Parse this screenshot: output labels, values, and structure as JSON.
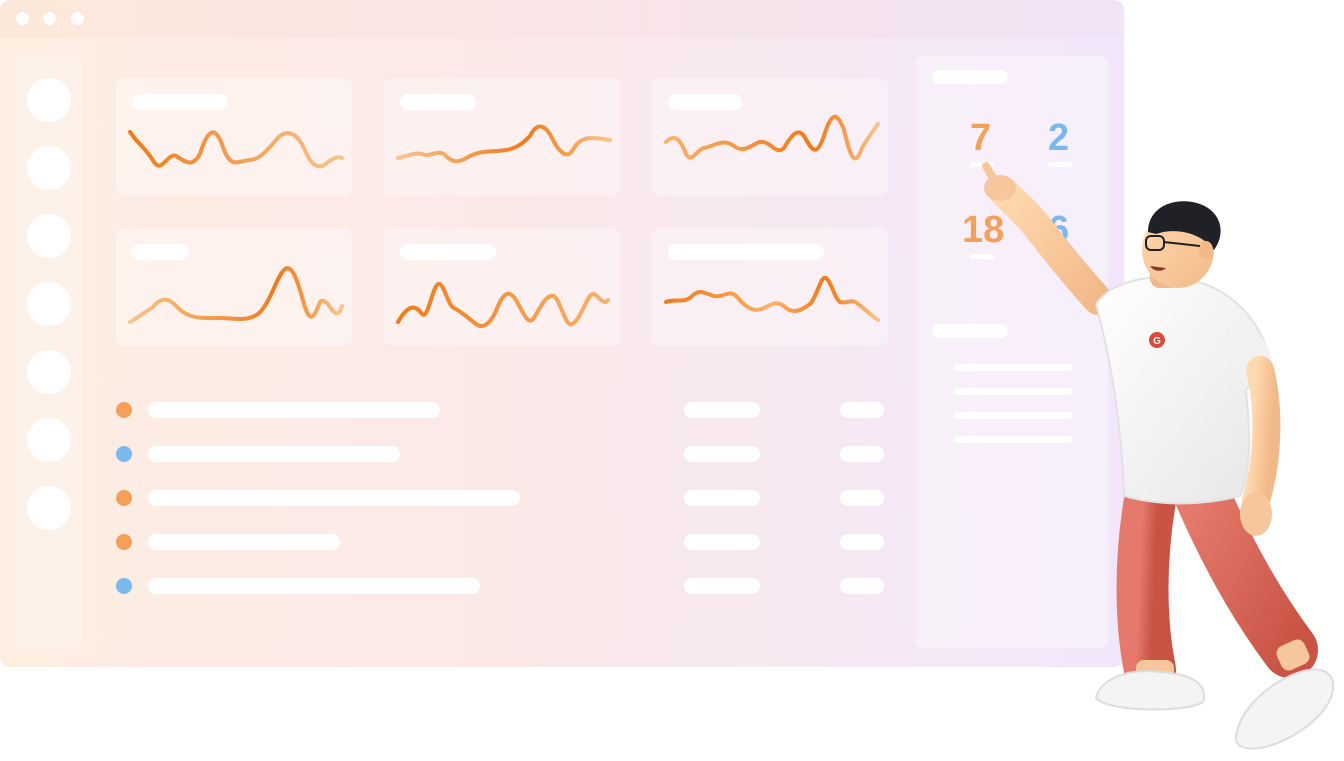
{
  "window": {
    "controls": [
      "window-dot-1",
      "window-dot-2",
      "window-dot-3"
    ]
  },
  "sidebar": {
    "items": [
      "nav-1",
      "nav-2",
      "nav-3",
      "nav-4",
      "nav-5",
      "nav-6",
      "nav-7"
    ]
  },
  "stats": {
    "values": [
      "7",
      "2",
      "18",
      "6"
    ],
    "colors": [
      "#f5a05a",
      "#7bb8ec",
      "#f5a05a",
      "#7bb8ec"
    ]
  },
  "list": {
    "dot_colors": [
      "#f5a05a",
      "#7bb8ec",
      "#f5a05a",
      "#f5a05a",
      "#7bb8ec"
    ]
  },
  "theme": {
    "accent_orange": "#f07a1a",
    "accent_light_orange": "#f6b26b",
    "accent_blue": "#7bb8ec",
    "shirt_logo_color": "#d94a3a",
    "pants_color": "#d96a5c"
  },
  "icons": {
    "character": "person-pointing-illustration",
    "shirt_logo": "g-logo-icon"
  }
}
